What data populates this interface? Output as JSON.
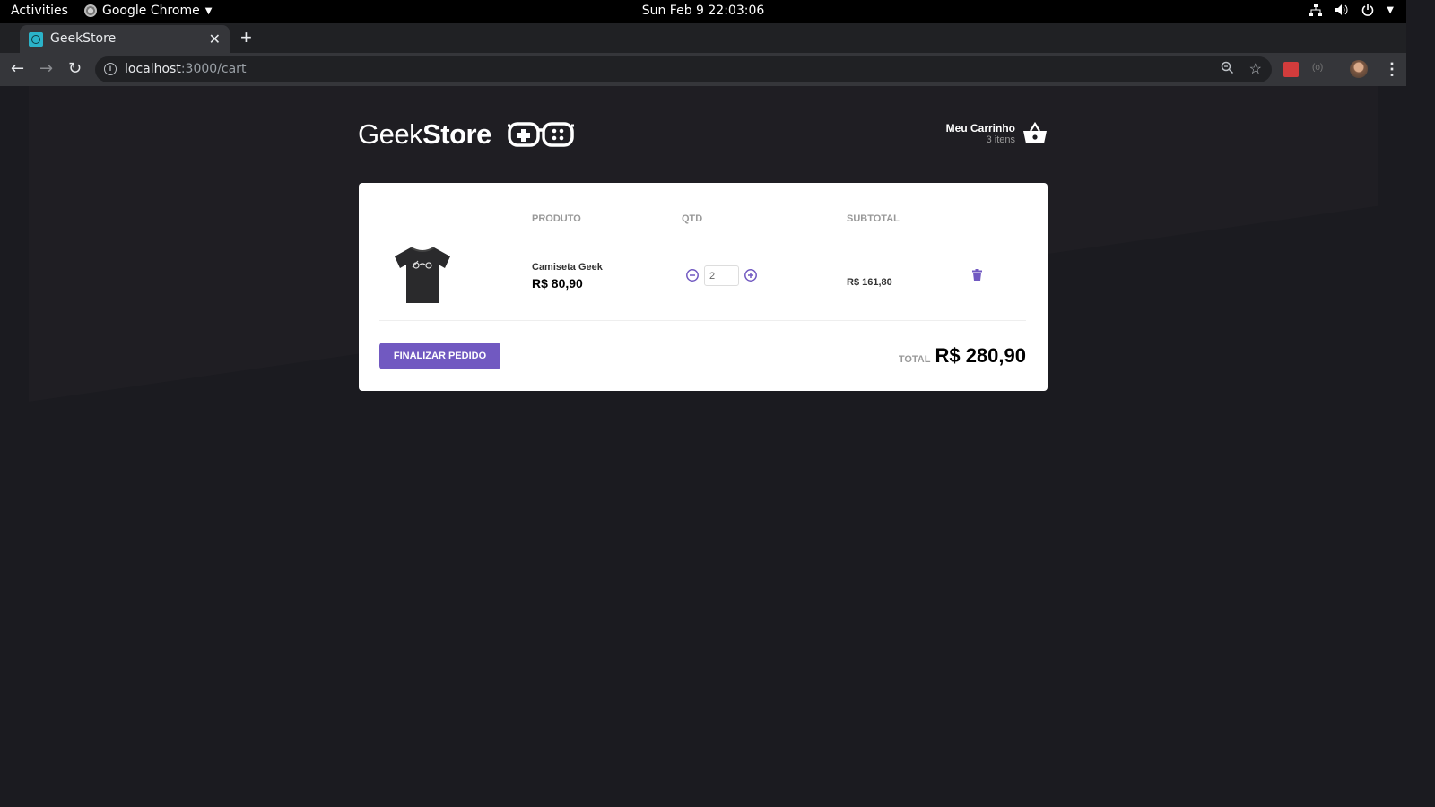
{
  "system_bar": {
    "activities": "Activities",
    "app_name": "Google Chrome",
    "clock": "Sun Feb 9  22:03:06"
  },
  "browser": {
    "tab_title": "GeekStore",
    "url_host": "localhost",
    "url_rest": ":3000/cart"
  },
  "store": {
    "logo_regular": "Geek",
    "logo_bold": "Store",
    "cart_label": "Meu Carrinho",
    "cart_count": "3 itens",
    "accent_color": "#7159c1"
  },
  "cart": {
    "columns": {
      "product": "PRODUTO",
      "qty": "QTD",
      "subtotal": "SUBTOTAL"
    },
    "items": [
      {
        "name": "Camiseta Geek",
        "price": "R$ 80,90",
        "quantity": "2",
        "subtotal": "R$ 161,80"
      }
    ],
    "checkout_label": "FINALIZAR PEDIDO",
    "total_label": "TOTAL",
    "total_value": "R$ 280,90"
  }
}
